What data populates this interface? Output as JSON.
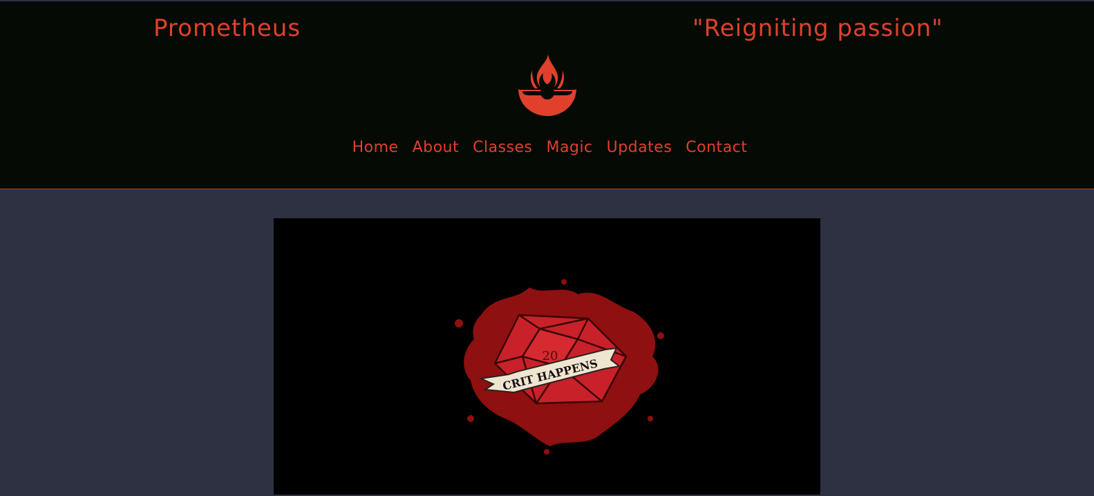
{
  "header": {
    "brand": "Prometheus",
    "tagline": "\"Reigniting passion\"",
    "logo_icon": "flame-bowl-icon"
  },
  "nav": {
    "items": [
      {
        "label": "Home"
      },
      {
        "label": "About"
      },
      {
        "label": "Classes"
      },
      {
        "label": "Magic"
      },
      {
        "label": "Updates"
      },
      {
        "label": "Contact"
      }
    ]
  },
  "hero": {
    "image_icon": "d20-crit-happens-emblem",
    "die_number": "20",
    "banner_text": "CRIT HAPPENS"
  },
  "colors": {
    "accent": "#e0402c",
    "header_bg": "#050a05",
    "page_bg": "#2e3142",
    "hero_bg": "#000000",
    "die_red": "#c8212a",
    "banner_cream": "#efe6d2"
  }
}
